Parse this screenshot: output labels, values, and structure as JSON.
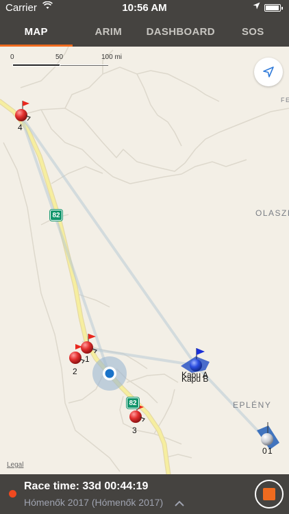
{
  "status_bar": {
    "carrier": "Carrier",
    "time": "10:56 AM",
    "battery_level": 0.95
  },
  "tabs": [
    {
      "label": "MAP",
      "active": true
    },
    {
      "label": "ARIM",
      "active": false
    },
    {
      "label": "DASHBOARD",
      "active": false
    },
    {
      "label": "SOS",
      "active": false
    }
  ],
  "map": {
    "scale": {
      "t0": "0",
      "t50": "50",
      "t100": "100 mi"
    },
    "places": {
      "fe": "FE",
      "olaszfa": "OLASZFA",
      "epleny": "EPLÉNY"
    },
    "highway_82": "82",
    "legal": "Legal",
    "markers": {
      "m4": "4",
      "m1": "1",
      "m2": "2",
      "m3": "3",
      "kapu_a": "Kapu A",
      "kapu_b": "Kapu B",
      "m0": "0",
      "m1b": "1"
    },
    "colors": {
      "accent": "#f06b1f",
      "bar": "#454340",
      "user_location": "#1a73c9"
    }
  },
  "footer": {
    "race_time": "Race time: 33d 00:44:19",
    "event": "Hómenők 2017 (Hómenők 2017)"
  }
}
